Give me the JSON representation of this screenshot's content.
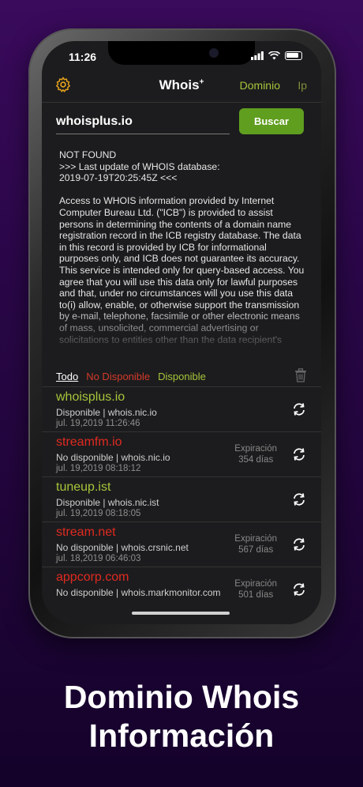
{
  "status_bar": {
    "time": "11:26"
  },
  "navbar": {
    "title": "Whois",
    "title_sup": "+",
    "segments": [
      "Dominio",
      "Ip"
    ]
  },
  "search": {
    "value": "whoisplus.io",
    "button_label": "Buscar"
  },
  "whois_result": "NOT FOUND\n>>> Last update of WHOIS database:\n2019-07-19T20:25:45Z <<<\n\nAccess to WHOIS information provided by Internet Computer Bureau Ltd. (\"ICB\") is provided to assist persons in determining the contents of a domain name registration record in the ICB registry database. The data in this record is provided by ICB for informational purposes only, and ICB does not guarantee its accuracy. This service is intended only for query-based access. You agree that you will use this data only for lawful purposes and that, under no circumstances will you use this data to(i) allow, enable, or otherwise support the transmission by e-mail, telephone, facsimile or other electronic means of mass, unsolicited, commercial advertising or solicitations to entities other than the data recipient's",
  "filters": {
    "all": "Todo",
    "unavailable": "No Disponible",
    "available": "Disponible"
  },
  "history": [
    {
      "domain": "whoisplus.io",
      "status": "Disponible | whois.nic.io",
      "date": "jul. 19,2019  11:26:46",
      "available": true,
      "exp_label": "",
      "exp_days": ""
    },
    {
      "domain": "streamfm.io",
      "status": "No disponible | whois.nic.io",
      "date": "jul. 19,2019  08:18:12",
      "available": false,
      "exp_label": "Expiración",
      "exp_days": "354 días"
    },
    {
      "domain": "tuneup.ist",
      "status": "Disponible | whois.nic.ist",
      "date": "jul. 19,2019  08:18:05",
      "available": true,
      "exp_label": "",
      "exp_days": ""
    },
    {
      "domain": "stream.net",
      "status": "No disponible | whois.crsnic.net",
      "date": "jul. 18,2019  06:46:03",
      "available": false,
      "exp_label": "Expiración",
      "exp_days": "567 días"
    },
    {
      "domain": "appcorp.com",
      "status": "No disponible | whois.markmonitor.com",
      "date": "",
      "available": false,
      "exp_label": "Expiración",
      "exp_days": "501 días"
    }
  ],
  "caption": {
    "line1": "Dominio Whois",
    "line2": "Información"
  },
  "colors": {
    "available": "#a6c53a",
    "unavailable": "#e02a20",
    "button": "#5f9e1e"
  }
}
